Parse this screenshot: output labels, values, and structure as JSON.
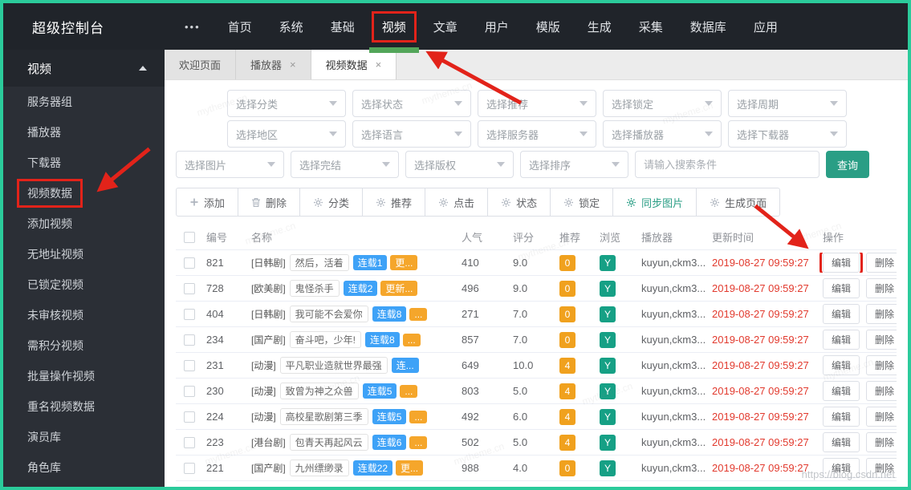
{
  "brand": "超级控制台",
  "topnav": {
    "more": "•••",
    "items": [
      {
        "name": "home",
        "label": "首页"
      },
      {
        "name": "system",
        "label": "系统"
      },
      {
        "name": "basic",
        "label": "基础"
      },
      {
        "name": "video",
        "label": "视频",
        "active": true,
        "annotated": true
      },
      {
        "name": "article",
        "label": "文章"
      },
      {
        "name": "user",
        "label": "用户"
      },
      {
        "name": "template",
        "label": "模版"
      },
      {
        "name": "generate",
        "label": "生成"
      },
      {
        "name": "collect",
        "label": "采集"
      },
      {
        "name": "database",
        "label": "数据库"
      },
      {
        "name": "application",
        "label": "应用"
      }
    ]
  },
  "sidebar": {
    "group_label": "视频",
    "items": [
      {
        "name": "server-group",
        "label": "服务器组"
      },
      {
        "name": "player",
        "label": "播放器"
      },
      {
        "name": "downloader",
        "label": "下载器"
      },
      {
        "name": "video-data",
        "label": "视频数据",
        "annotated": true
      },
      {
        "name": "add-video",
        "label": "添加视频"
      },
      {
        "name": "no-address-video",
        "label": "无地址视频"
      },
      {
        "name": "locked-video",
        "label": "已锁定视频"
      },
      {
        "name": "unreviewed-video",
        "label": "未审核视频"
      },
      {
        "name": "points-video",
        "label": "需积分视频"
      },
      {
        "name": "batch-operate-video",
        "label": "批量操作视频"
      },
      {
        "name": "duplicate-video-data",
        "label": "重名视频数据"
      },
      {
        "name": "actor-library",
        "label": "演员库"
      },
      {
        "name": "role-library",
        "label": "角色库"
      }
    ]
  },
  "tabs": [
    {
      "name": "welcome",
      "label": "欢迎页面",
      "closable": false,
      "active": false
    },
    {
      "name": "player",
      "label": "播放器",
      "closable": true,
      "active": false
    },
    {
      "name": "video-data",
      "label": "视频数据",
      "closable": true,
      "active": true
    }
  ],
  "filters": {
    "row1": [
      {
        "name": "category",
        "label": "选择分类"
      },
      {
        "name": "status",
        "label": "选择状态"
      },
      {
        "name": "recommend",
        "label": "选择推荐"
      },
      {
        "name": "lock",
        "label": "选择锁定"
      },
      {
        "name": "period",
        "label": "选择周期"
      }
    ],
    "row2": [
      {
        "name": "region",
        "label": "选择地区"
      },
      {
        "name": "language",
        "label": "选择语言"
      },
      {
        "name": "server",
        "label": "选择服务器"
      },
      {
        "name": "player",
        "label": "选择播放器"
      },
      {
        "name": "downloader",
        "label": "选择下载器"
      }
    ],
    "row3": [
      {
        "name": "image",
        "label": "选择图片"
      },
      {
        "name": "finished",
        "label": "选择完结"
      },
      {
        "name": "copyright",
        "label": "选择版权"
      },
      {
        "name": "sort",
        "label": "选择排序"
      }
    ],
    "search_placeholder": "请输入搜索条件",
    "query_label": "查询"
  },
  "toolbar": [
    {
      "name": "add",
      "icon": "plus",
      "label": "添加"
    },
    {
      "name": "delete",
      "icon": "trash",
      "label": "删除"
    },
    {
      "name": "classify",
      "icon": "gear",
      "label": "分类"
    },
    {
      "name": "recommend",
      "icon": "gear",
      "label": "推荐"
    },
    {
      "name": "click",
      "icon": "gear",
      "label": "点击"
    },
    {
      "name": "status",
      "icon": "gear",
      "label": "状态"
    },
    {
      "name": "lock",
      "icon": "gear",
      "label": "锁定"
    },
    {
      "name": "sync-images",
      "icon": "gear",
      "label": "同步图片",
      "accent": true
    },
    {
      "name": "generate-pages",
      "icon": "gear",
      "label": "生成页面"
    }
  ],
  "table": {
    "columns": {
      "id": "编号",
      "name": "名称",
      "popularity": "人气",
      "score": "评分",
      "recommend": "推荐",
      "views": "浏览",
      "player": "播放器",
      "updated": "更新时间",
      "actions": "操作"
    },
    "action_labels": {
      "edit": "编辑",
      "delete": "删除"
    },
    "rows": [
      {
        "id": "821",
        "category": "[日韩剧]",
        "title": "然后，活着",
        "serial": "连载1",
        "more": "更...",
        "popularity": "410",
        "score": "9.0",
        "recommend": "0",
        "views": "Y",
        "player": "kuyun,ckm3...",
        "updated": "2019-08-27 09:59:27",
        "edit_annotated": true
      },
      {
        "id": "728",
        "category": "[欧美剧]",
        "title": "鬼怪杀手",
        "serial": "连载2",
        "more": "更新...",
        "popularity": "496",
        "score": "9.0",
        "recommend": "0",
        "views": "Y",
        "player": "kuyun,ckm3...",
        "updated": "2019-08-27 09:59:27"
      },
      {
        "id": "404",
        "category": "[日韩剧]",
        "title": "我可能不会爱你",
        "serial": "连载8",
        "more": "...",
        "popularity": "271",
        "score": "7.0",
        "recommend": "0",
        "views": "Y",
        "player": "kuyun,ckm3...",
        "updated": "2019-08-27 09:59:27"
      },
      {
        "id": "234",
        "category": "[国产剧]",
        "title": "奋斗吧，少年!",
        "serial": "连载8",
        "more": "...",
        "popularity": "857",
        "score": "7.0",
        "recommend": "0",
        "views": "Y",
        "player": "kuyun,ckm3...",
        "updated": "2019-08-27 09:59:27"
      },
      {
        "id": "231",
        "category": "[动漫]",
        "title": "平凡职业造就世界最强",
        "serial": "连...",
        "more": "",
        "popularity": "649",
        "score": "10.0",
        "recommend": "4",
        "views": "Y",
        "player": "kuyun,ckm3...",
        "updated": "2019-08-27 09:59:27"
      },
      {
        "id": "230",
        "category": "[动漫]",
        "title": "致曾为神之众兽",
        "serial": "连载5",
        "more": "...",
        "popularity": "803",
        "score": "5.0",
        "recommend": "4",
        "views": "Y",
        "player": "kuyun,ckm3...",
        "updated": "2019-08-27 09:59:27"
      },
      {
        "id": "224",
        "category": "[动漫]",
        "title": "高校星歌剧第三季",
        "serial": "连载5",
        "more": "...",
        "popularity": "492",
        "score": "6.0",
        "recommend": "4",
        "views": "Y",
        "player": "kuyun,ckm3...",
        "updated": "2019-08-27 09:59:27"
      },
      {
        "id": "223",
        "category": "[港台剧]",
        "title": "包青天再起风云",
        "serial": "连载6",
        "more": "...",
        "popularity": "502",
        "score": "5.0",
        "recommend": "4",
        "views": "Y",
        "player": "kuyun,ckm3...",
        "updated": "2019-08-27 09:59:27"
      },
      {
        "id": "221",
        "category": "[国产剧]",
        "title": "九州缥缈录",
        "serial": "连载22",
        "more": "更...",
        "popularity": "988",
        "score": "4.0",
        "recommend": "0",
        "views": "Y",
        "player": "kuyun,ckm3...",
        "updated": "2019-08-27 09:59:27"
      }
    ]
  },
  "watermark": {
    "site": "mytheme.cn",
    "csdn": "https://blog.csdn.net"
  },
  "colors": {
    "frame_border": "#2bcb9b",
    "topbar_bg": "#20242a",
    "sidebar_bg": "#2b2f36",
    "accent_teal": "#2a9e85",
    "nav_active_green": "#53a65a",
    "annotation_red": "#e2231a",
    "badge_blue": "#3ea2f7",
    "badge_orange": "#f5a62b",
    "badge_green": "#16a085",
    "time_red": "#e23a2e"
  }
}
